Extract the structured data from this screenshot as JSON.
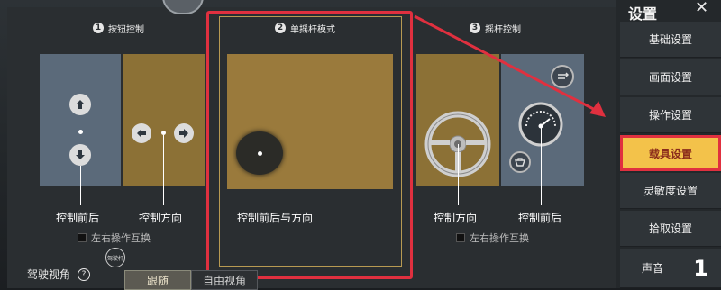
{
  "modes": [
    {
      "number": "1",
      "title": "按钮控制",
      "labels": [
        "控制前后",
        "控制方向"
      ],
      "swap_label": "左右操作互换"
    },
    {
      "number": "2",
      "title": "单摇杆模式",
      "labels": [
        "控制前后与方向"
      ]
    },
    {
      "number": "3",
      "title": "摇杆控制",
      "labels": [
        "控制方向",
        "控制前后"
      ],
      "swap_label": "左右操作互换"
    }
  ],
  "sidebar": {
    "title": "设置",
    "close": "✕",
    "items": [
      {
        "label": "基础设置"
      },
      {
        "label": "画面设置"
      },
      {
        "label": "操作设置"
      },
      {
        "label": "载具设置",
        "active": true
      },
      {
        "label": "灵敏度设置"
      },
      {
        "label": "拾取设置"
      },
      {
        "label": "声音"
      }
    ]
  },
  "bottom": {
    "label": "驾驶视角",
    "badge": "驾驶杆",
    "option_a": "跟随",
    "option_b": "自由视角",
    "page_number": "1"
  },
  "colors": {
    "highlight": "#e0303f",
    "active_tab": "#f3c24a"
  }
}
